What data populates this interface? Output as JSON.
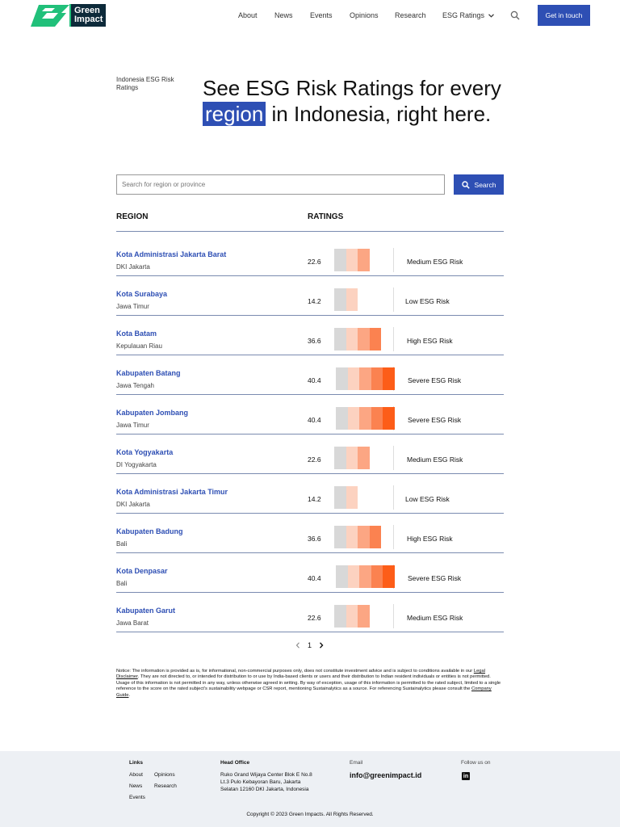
{
  "brand": {
    "line1": "Green",
    "line2": "Impact"
  },
  "nav": {
    "links": [
      "About",
      "News",
      "Events",
      "Opinions",
      "Research",
      "ESG Ratings"
    ],
    "cta": "Get in touch"
  },
  "hero": {
    "eyebrow": "Indonesia ESG Risk Ratings",
    "title_before": "See ESG Risk Ratings for every",
    "title_highlight": "region",
    "title_after": "in Indonesia, right here."
  },
  "search": {
    "placeholder": "Search for region or province",
    "button": "Search"
  },
  "table": {
    "col_region": "REGION",
    "col_ratings": "RATINGS",
    "rows": [
      {
        "name": "Kota Administrasi Jakarta Barat",
        "province": "DKI Jakarta",
        "score": "22.6",
        "level": 3,
        "label": "Medium ESG Risk"
      },
      {
        "name": "Kota Surabaya",
        "province": "Jawa Timur",
        "score": "14.2",
        "level": 2,
        "label": "Low ESG Risk"
      },
      {
        "name": "Kota Batam",
        "province": "Kepulauan Riau",
        "score": "36.6",
        "level": 4,
        "label": "High ESG Risk"
      },
      {
        "name": "Kabupaten Batang",
        "province": "Jawa Tengah",
        "score": "40.4",
        "level": 5,
        "label": "Severe ESG Risk"
      },
      {
        "name": "Kabupaten Jombang",
        "province": "Jawa Timur",
        "score": "40.4",
        "level": 5,
        "label": "Severe ESG Risk"
      },
      {
        "name": "Kota Yogyakarta",
        "province": "DI Yogyakarta",
        "score": "22.6",
        "level": 3,
        "label": "Medium ESG Risk"
      },
      {
        "name": "Kota Administrasi Jakarta Timur",
        "province": "DKI Jakarta",
        "score": "14.2",
        "level": 2,
        "label": "Low ESG Risk"
      },
      {
        "name": "Kabupaten Badung",
        "province": "Bali",
        "score": "36.6",
        "level": 4,
        "label": "High ESG Risk"
      },
      {
        "name": "Kota Denpasar",
        "province": "Bali",
        "score": "40.4",
        "level": 5,
        "label": "Severe ESG Risk"
      },
      {
        "name": "Kabupaten Garut",
        "province": "Jawa Barat",
        "score": "22.6",
        "level": 3,
        "label": "Medium ESG Risk"
      }
    ]
  },
  "pagination": {
    "current": "1"
  },
  "notice": {
    "part1": "Notice: The information is provided as is, for informational, non-commercial purposes only, does not constitute investment advice and is subject to conditions available in our ",
    "link1": "Legal Disclaimer",
    "part2": ". They are not directed to, or intended for distribution to or use by India-based clients or users and their distribution to Indian resident individuals or entities is not permitted. Usage of this information is not permitted in any way, unless otherwise agreed in writing. By way of exception, usage of this information is permitted to the rated subject, limited to a single reference to the score on the rated subject's sustainability webpage or CSR report, mentioning Sustainalytics as a source. For referencing Sustainalytics please consult the ",
    "link2": "Company Guide",
    "part3": "."
  },
  "footer": {
    "links_heading": "Links",
    "links": [
      "About",
      "Opinions",
      "News",
      "Research",
      "Events"
    ],
    "office_heading": "Head Office",
    "address": "Ruko Grand Wijaya Center Blok E No.8 Lt.3 Pulo Kebayoran Baru, Jakarta Selatan 12160 DKI Jakarta, Indonesia",
    "email_label": "Email",
    "email": "info@greenimpact.id",
    "follow_label": "Follow us on",
    "copyright": "Copyright © 2023 Green Impacts. All Rights Reserved."
  },
  "colors": {
    "accent": "#2e4fb4",
    "logo_green": "#21c07a",
    "logo_dark": "#0d2a3a",
    "risk_scale": [
      "#d8d8d8",
      "#fcd2c0",
      "#fca683",
      "#fb8250",
      "#fd5d18"
    ]
  }
}
